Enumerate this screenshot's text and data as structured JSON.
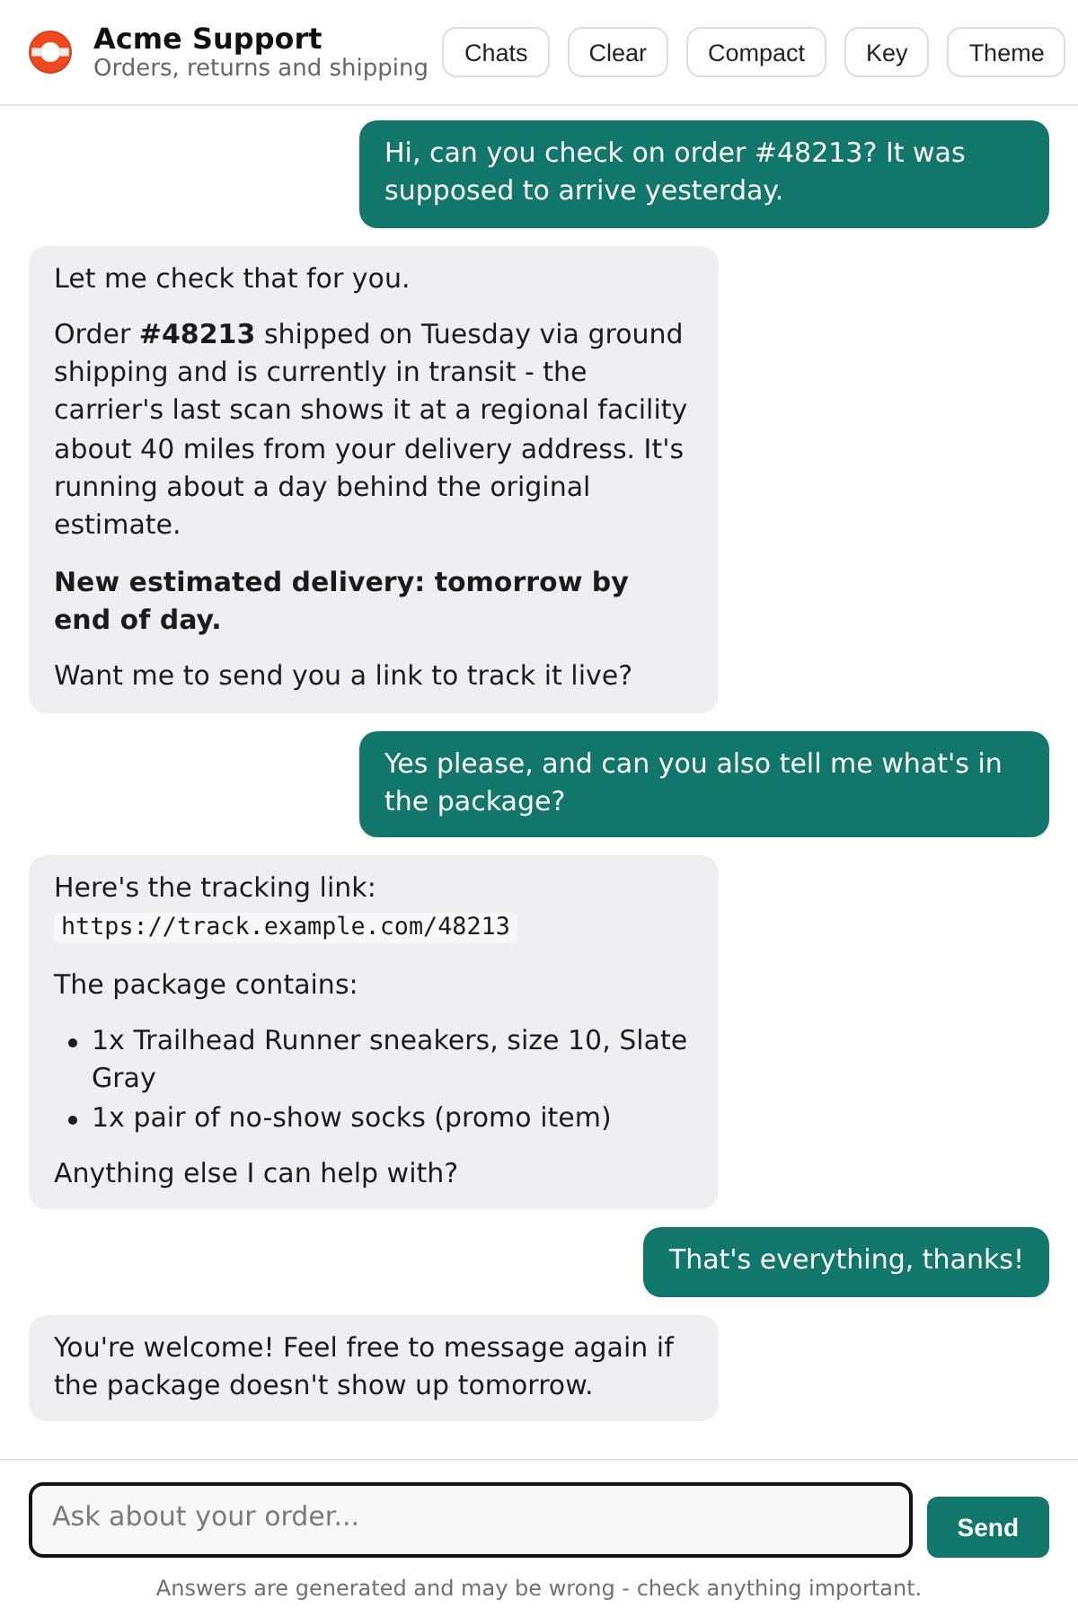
{
  "header": {
    "title": "Acme Support",
    "subtitle": "Orders, returns and shipping",
    "buttons": [
      "Chats",
      "Clear",
      "Compact",
      "Key",
      "Theme"
    ]
  },
  "messages": [
    {
      "kind": "user",
      "blocks": [
        {
          "kind": "paragraph",
          "text": "Hi, can you check on order #48213? It was supposed to arrive yesterday."
        }
      ]
    },
    {
      "kind": "assistant",
      "blocks": [
        {
          "kind": "paragraph",
          "text": "Let me check that for you."
        },
        {
          "kind": "paragraph",
          "text": "Order **#48213** shipped on Tuesday via ground shipping and is currently in transit - the carrier's last scan shows it at a regional facility about 40 miles from your delivery address. It's running about a day behind the original estimate."
        },
        {
          "kind": "bold_paragraph",
          "text": "New estimated delivery: tomorrow by end of day."
        },
        {
          "kind": "paragraph",
          "text": "Want me to send you a link to track it live?"
        }
      ]
    },
    {
      "kind": "user",
      "blocks": [
        {
          "kind": "paragraph",
          "text": "Yes please, and can you also tell me what's in the package?"
        }
      ]
    },
    {
      "kind": "assistant",
      "blocks": [
        {
          "kind": "code_paragraph",
          "text": "Here's the tracking link:",
          "code": "https://track.example.com/48213"
        },
        {
          "kind": "paragraph",
          "text": "The package contains:"
        },
        {
          "kind": "list",
          "items": [
            "1x Trailhead Runner sneakers, size 10, Slate Gray",
            "1x pair of no-show socks (promo item)"
          ]
        },
        {
          "kind": "paragraph",
          "text": "Anything else I can help with?"
        }
      ]
    },
    {
      "kind": "user",
      "blocks": [
        {
          "kind": "paragraph",
          "text": "That's everything, thanks!"
        }
      ]
    },
    {
      "kind": "assistant",
      "blocks": [
        {
          "kind": "paragraph",
          "text": "You're welcome! Feel free to message again if the package doesn't show up tomorrow."
        }
      ]
    }
  ],
  "composer": {
    "placeholder": "Ask about your order...",
    "button": "Send"
  },
  "footer_note": "Answers are generated and may be wrong - check anything important."
}
